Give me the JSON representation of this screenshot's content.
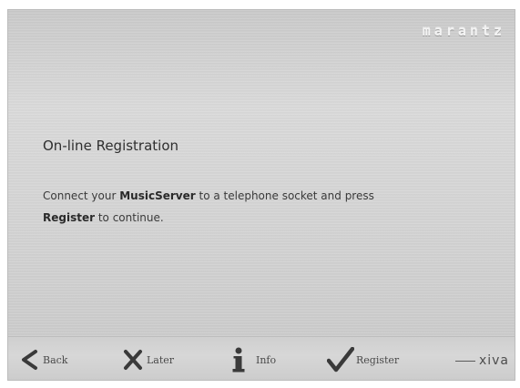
{
  "brand": {
    "logo_text": "marantz"
  },
  "main": {
    "title": "On-line Registration",
    "message": {
      "part1": "Connect your ",
      "bold1": "MusicServer",
      "part2": " to a telephone socket and press ",
      "bold2": "Register",
      "part3": " to continue."
    }
  },
  "toolbar": {
    "buttons": [
      {
        "label": "Back",
        "icon": "back-arrow-icon"
      },
      {
        "label": "Later",
        "icon": "cross-icon"
      },
      {
        "label": "Info",
        "icon": "info-icon"
      },
      {
        "label": "Register",
        "icon": "checkmark-icon"
      }
    ],
    "partner_logo": "xiva"
  },
  "colors": {
    "text": "#2f2f2f",
    "icon": "#3a3a3a",
    "panel": "#d4d4d4"
  }
}
